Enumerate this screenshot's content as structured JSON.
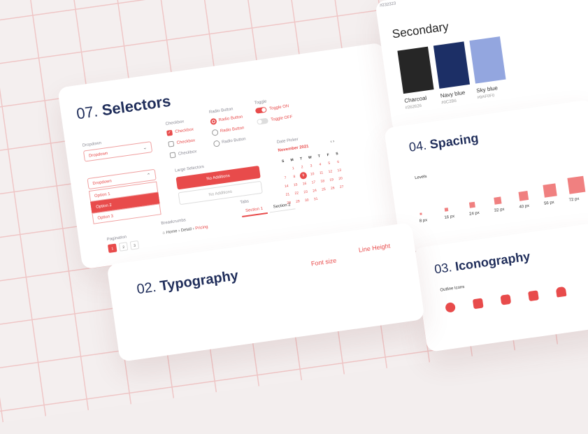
{
  "top_hex": "#232323",
  "secondary": {
    "title": "Secondary",
    "swatches": [
      {
        "name": "Charcoal",
        "hex": "#262626",
        "color": "#262626"
      },
      {
        "name": "Navy blue",
        "hex": "#0C2B6",
        "color": "#1c2f66"
      },
      {
        "name": "Sky blue",
        "hex": "#9AF0F0",
        "color": "#93a6df"
      }
    ]
  },
  "selectors": {
    "title_num": "07.",
    "title": "Selectors",
    "dropdown_label": "Dropdown",
    "dropdown_value": "Dropdown",
    "dropdown2_value": "Dropdown",
    "options": [
      "Option 1",
      "Option 2",
      "Option 3"
    ],
    "checkbox_label": "Checkbox",
    "checkboxes": [
      "Checkbox",
      "Checkbox",
      "Checkbox"
    ],
    "radio_label": "Radio Button",
    "radios": [
      "Radio Button",
      "Radio Button",
      "Radio Button"
    ],
    "toggle_label": "Toggle",
    "toggle_on": "Toggle ON",
    "toggle_off": "Toggle OFF",
    "large_label": "Large Selectors",
    "btn_primary": "No Additions",
    "btn_ghost": "No Additions",
    "date_label": "Date Picker",
    "month": "November 2021",
    "weekdays": [
      "S",
      "M",
      "T",
      "W",
      "T",
      "F",
      "S"
    ],
    "days": [
      "",
      "1",
      "2",
      "3",
      "4",
      "5",
      "6",
      "7",
      "8",
      "9",
      "10",
      "11",
      "12",
      "13",
      "14",
      "15",
      "16",
      "17",
      "18",
      "19",
      "20",
      "21",
      "22",
      "23",
      "24",
      "25",
      "26",
      "27",
      "28",
      "29",
      "30",
      "31"
    ],
    "today": "9",
    "pagination_label": "Pagination",
    "pages": [
      "1",
      "2",
      "3"
    ],
    "breadcrumb_label": "Breadcrumbs",
    "breadcrumb": [
      "Home",
      "Detail",
      "Pricing"
    ],
    "tabs_label": "Tabs",
    "tabs": [
      "Section 1",
      "Section 2"
    ]
  },
  "spacing": {
    "title_num": "04.",
    "title": "Spacing",
    "levels_label": "Levels",
    "levels": [
      {
        "label": "8 px",
        "size": 8
      },
      {
        "label": "16 px",
        "size": 16
      },
      {
        "label": "24 px",
        "size": 24
      },
      {
        "label": "32 px",
        "size": 32
      },
      {
        "label": "40 px",
        "size": 40
      },
      {
        "label": "56 px",
        "size": 56
      },
      {
        "label": "72 px",
        "size": 72
      }
    ]
  },
  "icons": {
    "title_num": "03.",
    "title": "Iconography",
    "outline_label": "Outline Icons",
    "icon_names": [
      "circle-icon",
      "document-icon",
      "grid-icon",
      "calendar-icon",
      "lock-icon"
    ]
  },
  "typography": {
    "title_num": "02.",
    "title": "Typography",
    "font_size": "Font size",
    "line_height": "Line Height"
  },
  "colors": {
    "accent": "#e84b4b",
    "navy": "#1f2d5a"
  }
}
